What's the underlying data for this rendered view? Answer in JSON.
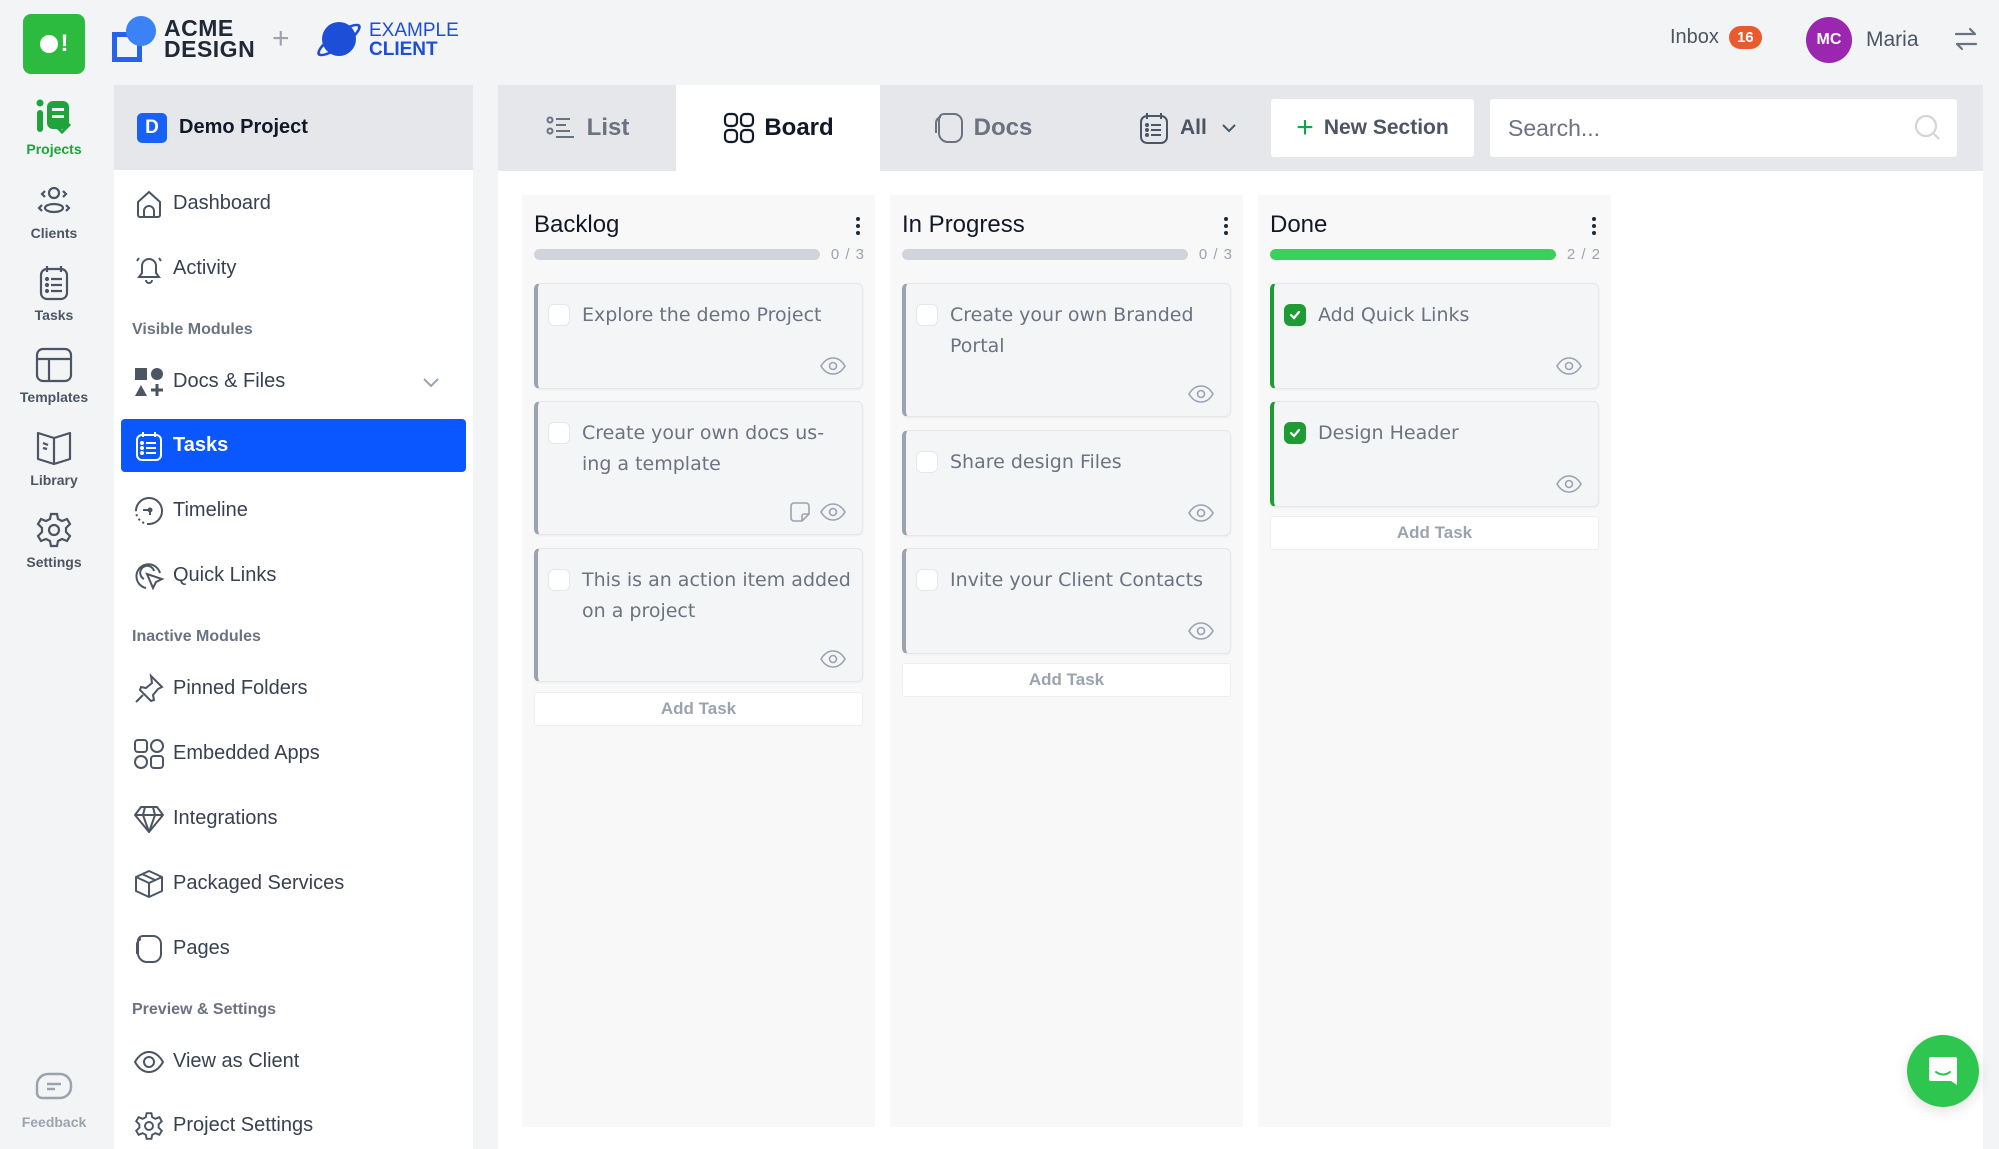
{
  "header": {
    "app_logo_text": "!",
    "agency_brand": [
      "ACME",
      "DESIGN"
    ],
    "client_brand": [
      "EXAMPLE",
      "CLIENT"
    ],
    "plus": "+",
    "inbox_label": "Inbox",
    "inbox_count": "16",
    "user_initials": "MC",
    "user_name": "Maria",
    "colors": {
      "app_green": "#2dbb3f",
      "badge_orange": "#ea5a2c",
      "avatar_purple": "#9b27b0"
    }
  },
  "rail": {
    "items": [
      {
        "label": "Projects",
        "icon": "projects-icon",
        "active": true
      },
      {
        "label": "Clients",
        "icon": "clients-icon"
      },
      {
        "label": "Tasks",
        "icon": "tasks-icon"
      },
      {
        "label": "Templates",
        "icon": "templates-icon"
      },
      {
        "label": "Library",
        "icon": "library-icon"
      },
      {
        "label": "Settings",
        "icon": "settings-icon"
      }
    ],
    "feedback_label": "Feedback"
  },
  "project": {
    "badge": "D",
    "name": "Demo Project",
    "nav_top": [
      {
        "label": "Dashboard",
        "icon": "home-icon"
      },
      {
        "label": "Activity",
        "icon": "bell-icon"
      }
    ],
    "visible_modules_label": "Visible Modules",
    "visible_modules": [
      {
        "label": "Docs & Files",
        "icon": "shapes-icon",
        "expandable": true
      },
      {
        "label": "Tasks",
        "icon": "tasks-icon",
        "active": true
      },
      {
        "label": "Timeline",
        "icon": "timeline-icon"
      },
      {
        "label": "Quick Links",
        "icon": "cursor-click-icon"
      }
    ],
    "inactive_modules_label": "Inactive Modules",
    "inactive_modules": [
      {
        "label": "Pinned Folders",
        "icon": "pin-icon"
      },
      {
        "label": "Embedded Apps",
        "icon": "apps-icon"
      },
      {
        "label": "Integrations",
        "icon": "diamond-icon"
      },
      {
        "label": "Packaged Services",
        "icon": "package-icon"
      },
      {
        "label": "Pages",
        "icon": "pages-icon"
      }
    ],
    "preview_label": "Preview & Settings",
    "preview_items": [
      {
        "label": "View as Client",
        "icon": "eye-icon"
      },
      {
        "label": "Project Settings",
        "icon": "gear-icon"
      }
    ]
  },
  "toolbar": {
    "tabs": [
      {
        "label": "List",
        "icon": "list-icon"
      },
      {
        "label": "Board",
        "icon": "board-icon",
        "active": true
      },
      {
        "label": "Docs",
        "icon": "docs-icon"
      }
    ],
    "filter_value": "All",
    "new_section_label": "New Section",
    "search_placeholder": "Search...",
    "search_value": ""
  },
  "board": {
    "columns": [
      {
        "title": "Backlog",
        "completed": 0,
        "total": 3,
        "progress_label": "0 / 3",
        "cards": [
          {
            "text": "Explore the demo Project",
            "done": false,
            "has_doc": false
          },
          {
            "text": "Create your own docs us-ing a template",
            "done": false,
            "has_doc": true
          },
          {
            "text": "This is an action item added on a project",
            "done": false,
            "has_doc": false
          }
        ],
        "add_label": "Add Task"
      },
      {
        "title": "In Progress",
        "completed": 0,
        "total": 3,
        "progress_label": "0 / 3",
        "cards": [
          {
            "text": "Create your own Branded Portal",
            "done": false,
            "has_doc": false
          },
          {
            "text": "Share design Files",
            "done": false,
            "has_doc": false
          },
          {
            "text": "Invite your Client Contacts",
            "done": false,
            "has_doc": false
          }
        ],
        "add_label": "Add Task"
      },
      {
        "title": "Done",
        "completed": 2,
        "total": 2,
        "progress_label": "2 / 2",
        "cards": [
          {
            "text": "Add Quick Links",
            "done": true,
            "has_doc": false
          },
          {
            "text": "Design Header",
            "done": true,
            "has_doc": false
          }
        ],
        "add_label": "Add Task"
      }
    ],
    "colors": {
      "progress_fill": "#3ccf5a",
      "done_accent": "#1f9b34",
      "active_blue": "#0a57ff"
    }
  }
}
